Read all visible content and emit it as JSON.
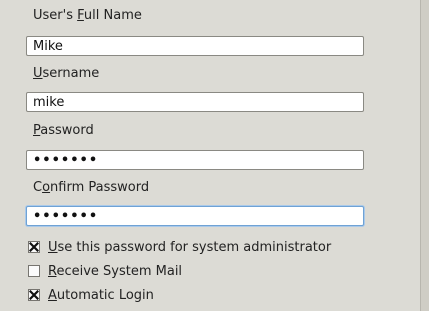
{
  "form": {
    "full_name": {
      "label_mnemonic": "",
      "label_pre": "User's ",
      "label_ul": "F",
      "label_post": "ull Name",
      "value": "Mike"
    },
    "username": {
      "label_pre": "",
      "label_ul": "U",
      "label_post": "sername",
      "value": "mike"
    },
    "password": {
      "label_pre": "",
      "label_ul": "P",
      "label_post": "assword",
      "value": "•••••••"
    },
    "confirm_password": {
      "label_pre": "C",
      "label_ul": "o",
      "label_post": "nfirm Password",
      "value": "•••••••"
    }
  },
  "options": [
    {
      "label_pre": "",
      "label_ul": "U",
      "label_post": "se this password for system administrator",
      "checked": true
    },
    {
      "label_pre": "",
      "label_ul": "R",
      "label_post": "eceive System Mail",
      "checked": false
    },
    {
      "label_pre": "",
      "label_ul": "A",
      "label_post": "utomatic Login",
      "checked": true
    }
  ]
}
